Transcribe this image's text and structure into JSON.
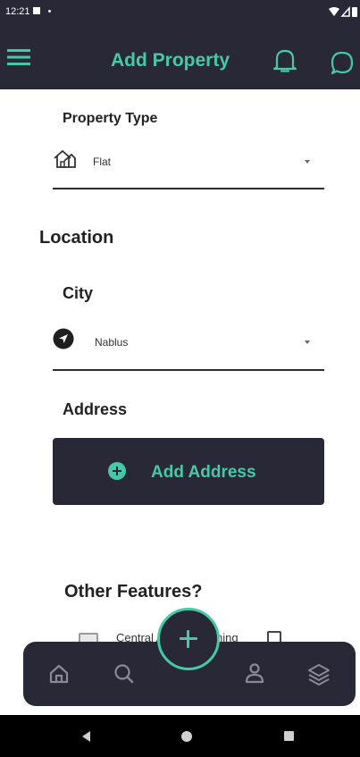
{
  "status_bar": {
    "time": "12:21",
    "icons": [
      "notification-square-icon",
      "notification-dot-icon",
      "wifi-icon",
      "signal-icon",
      "battery-icon"
    ]
  },
  "app_bar": {
    "title": "Add Property",
    "icons": [
      "menu-icon",
      "bell-icon",
      "chat-icon"
    ],
    "background": "#282836",
    "accent": "#46c9a4"
  },
  "property_type": {
    "label": "Property Type",
    "icon": "house-icon",
    "selected": "Flat"
  },
  "location": {
    "title": "Location",
    "city": {
      "label": "City",
      "icon": "navigation-arrow-icon",
      "selected": "Nablus"
    },
    "address": {
      "label": "Address",
      "button_label": "Add Address",
      "button_icon": "plus-circle-icon"
    }
  },
  "other_features": {
    "title": "Other Features?",
    "items": [
      {
        "label": "Central Air Conditioning",
        "icon": "air-conditioner-icon",
        "checked": false
      }
    ]
  },
  "bottom_nav": {
    "items": [
      "home-icon",
      "search-icon",
      "add-icon",
      "profile-icon",
      "layers-icon"
    ]
  },
  "system_nav": {
    "items": [
      "back-icon",
      "home-circle-icon",
      "recents-icon"
    ]
  }
}
